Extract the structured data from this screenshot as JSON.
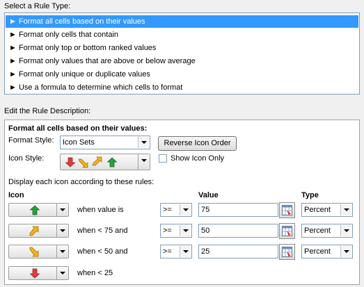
{
  "select_rule_type": {
    "label": "Select a Rule Type:",
    "items": [
      "► Format all cells based on their values",
      "► Format only cells that contain",
      "► Format only top or bottom ranked values",
      "► Format only values that are above or below average",
      "► Format only unique or duplicate values",
      "► Use a formula to determine which cells to format"
    ],
    "selected_index": 0
  },
  "edit_description": {
    "label": "Edit the Rule Description:",
    "heading": "Format all cells based on their values:",
    "format_style_label": "Format Style:",
    "format_style_value": "Icon Sets",
    "reverse_button": "Reverse Icon Order",
    "icon_style_label": "Icon Style:",
    "show_icon_only_label": "Show Icon Only",
    "show_icon_only_checked": false,
    "display_rules_text": "Display each icon according to these rules:",
    "col_icon": "Icon",
    "col_value": "Value",
    "col_type": "Type",
    "rules": [
      {
        "icon": "green-up-arrow-icon",
        "when": "when value is",
        "operator": ">=",
        "value": "75",
        "type": "Percent"
      },
      {
        "icon": "yellow-up-right-arrow-icon",
        "when": "when < 75 and",
        "operator": ">=",
        "value": "50",
        "type": "Percent"
      },
      {
        "icon": "yellow-down-right-arrow-icon",
        "when": "when < 50 and",
        "operator": ">=",
        "value": "25",
        "type": "Percent"
      },
      {
        "icon": "red-down-arrow-icon",
        "when": "when < 25"
      }
    ]
  },
  "colors": {
    "selection": "#3399ff",
    "green": "#22a33a",
    "yellow": "#f2b01e",
    "red": "#e23b3b"
  }
}
